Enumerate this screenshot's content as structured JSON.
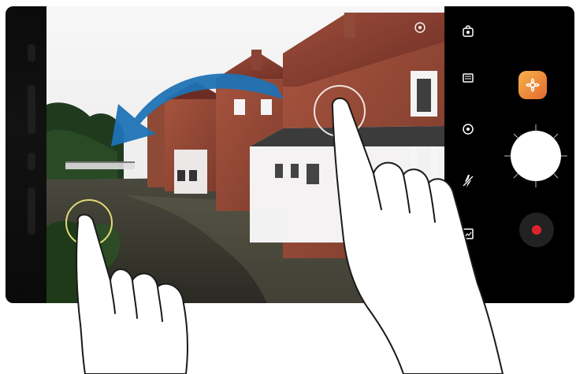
{
  "camera_app": {
    "screen": "camera-viewfinder",
    "gesture": "swipe-left-to-switch-mode",
    "toolbar": {
      "items": [
        {
          "name": "switch-camera-icon"
        },
        {
          "name": "aspect-ratio-icon"
        },
        {
          "name": "focus-mode-icon"
        },
        {
          "name": "flash-off-icon"
        },
        {
          "name": "gallery-icon"
        },
        {
          "name": "settings-icon"
        }
      ]
    },
    "effect_button": {
      "icon": "flower-filter-icon"
    },
    "shutter": {
      "icon": "shutter-icon"
    },
    "record": {
      "icon": "record-icon"
    },
    "overlays": {
      "arrow": {
        "color": "#1f72b5",
        "direction": "left"
      },
      "focus_ring_color": "#e9e27a",
      "tap_highlight_color": "#ffffff"
    }
  }
}
